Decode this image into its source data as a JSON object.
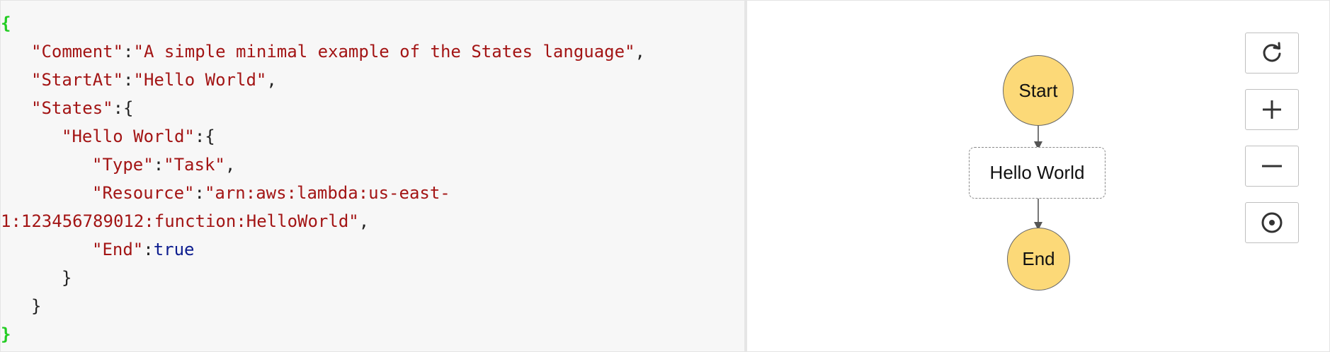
{
  "editor": {
    "lines": [
      {
        "indent": 0,
        "tokens": [
          {
            "t": "{",
            "c": "outer"
          }
        ]
      },
      {
        "indent": 1,
        "tokens": [
          {
            "t": "\"Comment\"",
            "c": "key"
          },
          {
            "t": ":",
            "c": "punc"
          },
          {
            "t": "\"A simple minimal example of the States language\"",
            "c": "str"
          },
          {
            "t": ",",
            "c": "punc"
          }
        ]
      },
      {
        "indent": 1,
        "tokens": [
          {
            "t": "\"StartAt\"",
            "c": "key"
          },
          {
            "t": ":",
            "c": "punc"
          },
          {
            "t": "\"Hello World\"",
            "c": "str"
          },
          {
            "t": ",",
            "c": "punc"
          }
        ]
      },
      {
        "indent": 1,
        "tokens": [
          {
            "t": "\"States\"",
            "c": "key"
          },
          {
            "t": ":{",
            "c": "punc"
          }
        ]
      },
      {
        "indent": 2,
        "tokens": [
          {
            "t": "\"Hello World\"",
            "c": "key"
          },
          {
            "t": ":{",
            "c": "punc"
          }
        ]
      },
      {
        "indent": 3,
        "tokens": [
          {
            "t": "\"Type\"",
            "c": "key"
          },
          {
            "t": ":",
            "c": "punc"
          },
          {
            "t": "\"Task\"",
            "c": "str"
          },
          {
            "t": ",",
            "c": "punc"
          }
        ]
      },
      {
        "indent": 3,
        "tokens": [
          {
            "t": "\"Resource\"",
            "c": "key"
          },
          {
            "t": ":",
            "c": "punc"
          },
          {
            "t": "\"arn:aws:lambda:us-east-",
            "c": "str"
          }
        ]
      },
      {
        "indent": 0,
        "tokens": [
          {
            "t": "1:123456789012:function:HelloWorld\"",
            "c": "str"
          },
          {
            "t": ",",
            "c": "punc"
          }
        ]
      },
      {
        "indent": 3,
        "tokens": [
          {
            "t": "\"End\"",
            "c": "key"
          },
          {
            "t": ":",
            "c": "punc"
          },
          {
            "t": "true",
            "c": "bool"
          }
        ]
      },
      {
        "indent": 2,
        "tokens": [
          {
            "t": "}",
            "c": "punc"
          }
        ]
      },
      {
        "indent": 1,
        "tokens": [
          {
            "t": "}",
            "c": "punc"
          }
        ]
      },
      {
        "indent": 0,
        "tokens": [
          {
            "t": "}",
            "c": "outer"
          }
        ]
      }
    ]
  },
  "graph": {
    "start_label": "Start",
    "task_label": "Hello World",
    "end_label": "End"
  },
  "controls": {
    "refresh_icon": "refresh-icon",
    "zoom_in_icon": "plus-icon",
    "zoom_out_icon": "minus-icon",
    "center_icon": "target-icon"
  },
  "colors": {
    "node_fill": "#fcd978",
    "json_string": "#a31515",
    "json_boolean": "#0d1d8f",
    "json_outer_brace": "#22cc22",
    "editor_background": "#f7f7f7"
  }
}
